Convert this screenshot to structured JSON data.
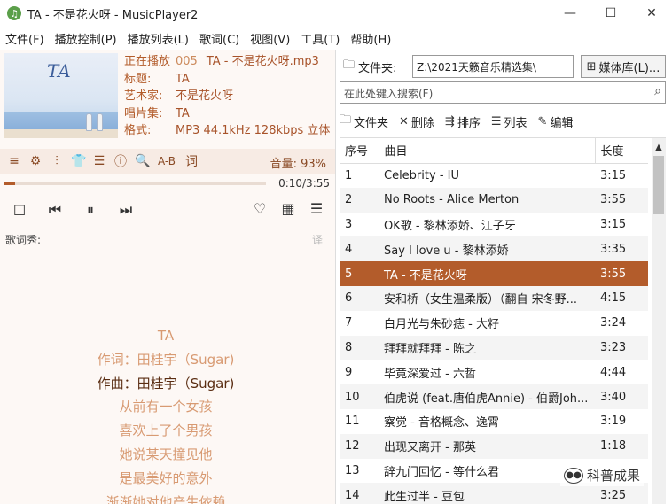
{
  "window": {
    "title": "TA - 不是花火呀 - MusicPlayer2",
    "app_icon": "music-note-icon",
    "minimize": "—",
    "maximize": "☐",
    "close": "✕"
  },
  "menu": [
    "文件(F)",
    "播放控制(P)",
    "播放列表(L)",
    "歌词(C)",
    "视图(V)",
    "工具(T)",
    "帮助(H)"
  ],
  "now_playing": {
    "label": "正在播放",
    "index": "005",
    "file": "TA - 不是花火呀.mp3",
    "title_key": "标题:",
    "title": "TA",
    "artist_key": "艺术家:",
    "artist": "不是花火呀",
    "album_key": "唱片集:",
    "album": "TA",
    "format_key": "格式:",
    "format": "MP3 44.1kHz 128kbps 立体",
    "album_art_text": "TA"
  },
  "controls": {
    "icons": [
      "≡",
      "⚙",
      "⫶",
      "👕",
      "☰",
      "ⓘ",
      "🔍"
    ],
    "ab": "A-B",
    "lyric_char": "词",
    "volume": "音量: 93%",
    "time": "0:10/3:55",
    "progress": 0.043
  },
  "lyrics": {
    "label": "歌词秀:",
    "translate": "译",
    "lines": [
      "TA",
      "作词：田桂宇（Sugar)",
      "作曲：田桂宇（Sugar)",
      "从前有一个女孩",
      "喜欢上了个男孩",
      "她说某天撞见他",
      "是最美好的意外",
      "渐渐她对他产生依赖"
    ],
    "current_index": 2
  },
  "library": {
    "folder_label": "文件夹:",
    "folder_path": "Z:\\2021天籁音乐精选集\\",
    "media_lib": "媒体库(L)...",
    "search_placeholder": "在此处键入搜索(F)",
    "toolbar": {
      "folder": "文件夹",
      "delete": "删除",
      "sort": "排序",
      "list": "列表",
      "edit": "编辑"
    }
  },
  "playlist": {
    "headers": {
      "no": "序号",
      "title": "曲目",
      "len": "长度"
    },
    "rows": [
      {
        "no": "1",
        "title": "Celebrity - IU",
        "len": "3:15"
      },
      {
        "no": "2",
        "title": "No Roots - Alice Merton",
        "len": "3:55"
      },
      {
        "no": "3",
        "title": "OK歌 - 黎林添娇、江子牙",
        "len": "3:15"
      },
      {
        "no": "4",
        "title": "Say I love u - 黎林添娇",
        "len": "3:35"
      },
      {
        "no": "5",
        "title": "TA - 不是花火呀",
        "len": "3:55"
      },
      {
        "no": "6",
        "title": "安和桥（女生温柔版）（翻自 宋冬野...",
        "len": "4:15"
      },
      {
        "no": "7",
        "title": "白月光与朱砂痣 - 大籽",
        "len": "3:24"
      },
      {
        "no": "8",
        "title": "拜拜就拜拜 - 陈之",
        "len": "3:23"
      },
      {
        "no": "9",
        "title": "毕竟深爱过 - 六哲",
        "len": "4:44"
      },
      {
        "no": "10",
        "title": "伯虎说 (feat.唐伯虎Annie) - 伯爵Joh...",
        "len": "3:40"
      },
      {
        "no": "11",
        "title": "察觉 - 音格概念、逸霄",
        "len": "3:19"
      },
      {
        "no": "12",
        "title": "出现又离开 - 那英",
        "len": "1:18"
      },
      {
        "no": "13",
        "title": "辞九门回忆 - 等什么君",
        "len": ""
      },
      {
        "no": "14",
        "title": "此生过半 - 豆包",
        "len": "3:25"
      }
    ],
    "selected": 4
  },
  "watermark": "科普成果"
}
